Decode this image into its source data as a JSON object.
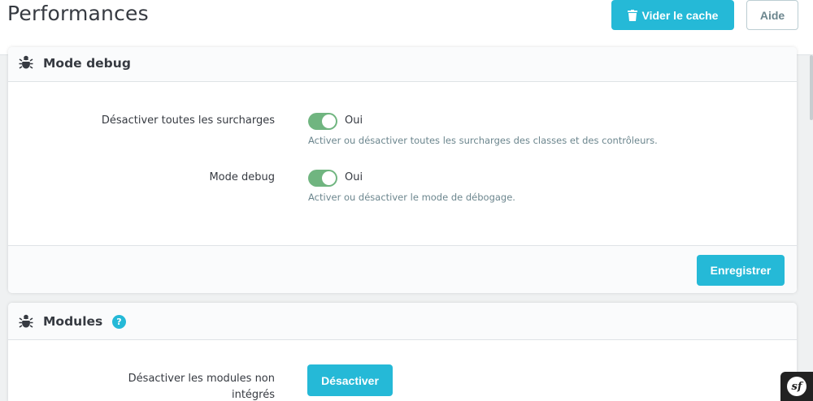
{
  "header": {
    "title": "Performances",
    "clear_cache_label": "Vider le cache",
    "clear_cache_icon": "trash-icon",
    "help_label": "Aide"
  },
  "debug_card": {
    "title": "Mode debug",
    "icon": "bug-icon",
    "rows": [
      {
        "label": "Désactiver toutes les surcharges",
        "toggle_value": "Oui",
        "enabled": true,
        "help": "Activer ou désactiver toutes les surcharges des classes et des contrôleurs."
      },
      {
        "label": "Mode debug",
        "toggle_value": "Oui",
        "enabled": true,
        "help": "Activer ou désactiver le mode de débogage."
      }
    ],
    "save_label": "Enregistrer"
  },
  "modules_card": {
    "title": "Modules",
    "icon": "bug-icon",
    "help_icon": "?",
    "row_label_line1": "Désactiver les modules non",
    "row_label_line2": "intégrés",
    "disable_label": "Désactiver"
  },
  "toolbar_badge": {
    "text": "sf"
  },
  "colors": {
    "primary": "#25b9d7",
    "toggle_on": "#70b580",
    "text": "#363a41",
    "muted": "#6c868e"
  }
}
